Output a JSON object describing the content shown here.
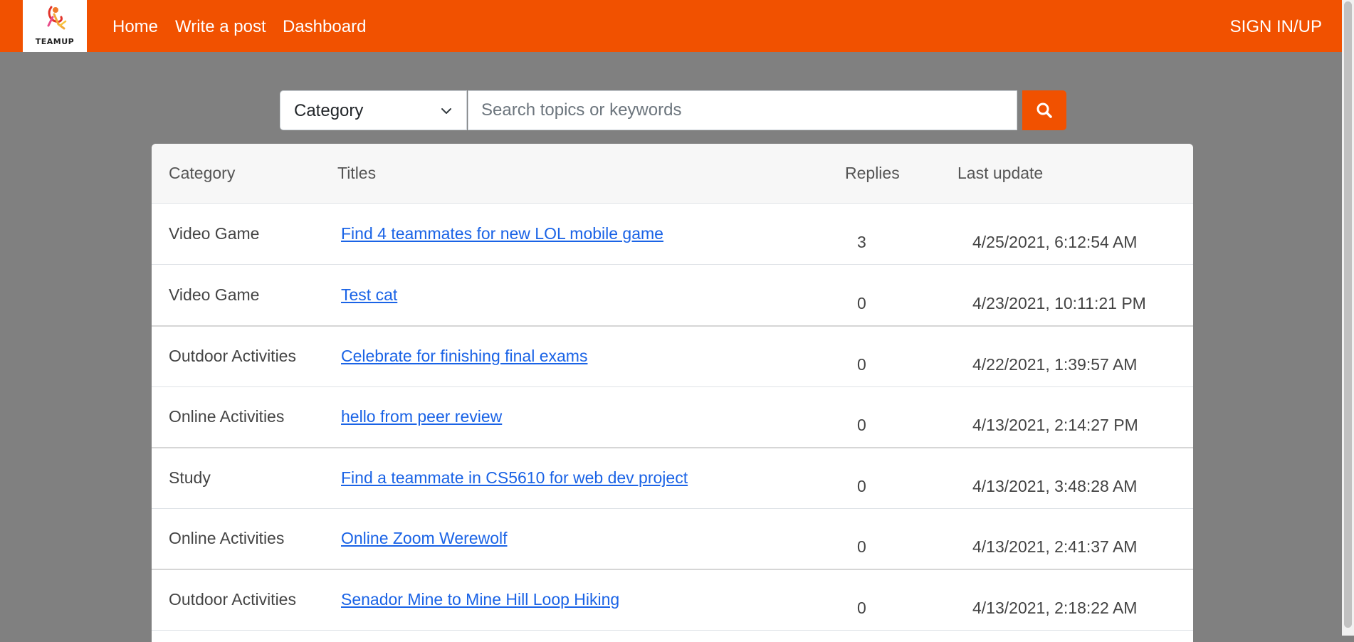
{
  "nav": {
    "logo_text": "TEAMUP",
    "home": "Home",
    "write_post": "Write a post",
    "dashboard": "Dashboard",
    "sign_in": "SIGN IN/UP"
  },
  "search": {
    "category_value": "Category",
    "placeholder": "Search topics or keywords",
    "icon": "search-icon"
  },
  "table": {
    "headers": {
      "category": "Category",
      "titles": "Titles",
      "replies": "Replies",
      "last_update": "Last update"
    },
    "rows": [
      {
        "category": "Video Game",
        "title": "Find 4 teammates for new LOL mobile game",
        "replies": "3",
        "last_update": "4/25/2021, 6:12:54 AM"
      },
      {
        "category": "Video Game",
        "title": "Test cat",
        "replies": "0",
        "last_update": "4/23/2021, 10:11:21 PM"
      },
      {
        "category": "Outdoor Activities",
        "title": "Celebrate for finishing final exams",
        "replies": "0",
        "last_update": "4/22/2021, 1:39:57 AM"
      },
      {
        "category": "Online Activities",
        "title": "hello from peer review",
        "replies": "0",
        "last_update": "4/13/2021, 2:14:27 PM"
      },
      {
        "category": "Study",
        "title": "Find a teammate in CS5610 for web dev project",
        "replies": "0",
        "last_update": "4/13/2021, 3:48:28 AM"
      },
      {
        "category": "Online Activities",
        "title": "Online Zoom Werewolf",
        "replies": "0",
        "last_update": "4/13/2021, 2:41:37 AM"
      },
      {
        "category": "Outdoor Activities",
        "title": "Senador Mine to Mine Hill Loop Hiking",
        "replies": "0",
        "last_update": "4/13/2021, 2:18:22 AM"
      }
    ]
  },
  "colors": {
    "brand": "#f15100",
    "background": "#808080",
    "link": "#1a63e6"
  }
}
